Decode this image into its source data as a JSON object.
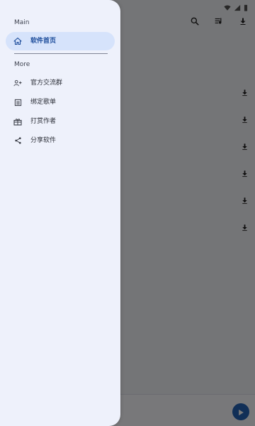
{
  "drawer": {
    "main_title": "Main",
    "more_title": "More",
    "items": [
      {
        "label": "软件首页",
        "icon": "home-icon",
        "active": true
      },
      {
        "label": "官方交流群",
        "icon": "group-add-icon",
        "active": false
      },
      {
        "label": "绑定歌单",
        "icon": "list-icon",
        "active": false
      },
      {
        "label": "打赏作者",
        "icon": "gift-icon",
        "active": false
      },
      {
        "label": "分享软件",
        "icon": "share-icon",
        "active": false
      }
    ]
  },
  "colors": {
    "accent": "#1b4b9a",
    "active_bg": "#d6e3fb",
    "drawer_bg": "#eef1fb"
  }
}
